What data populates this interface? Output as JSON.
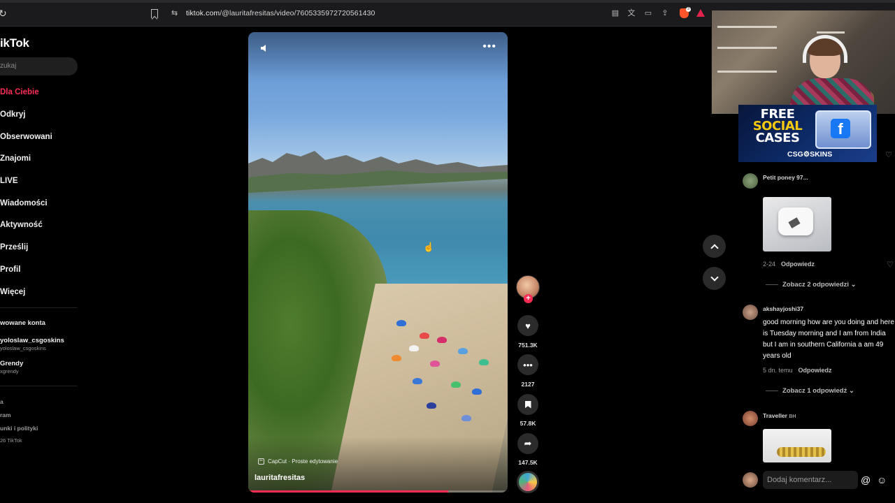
{
  "browser": {
    "url_host": "tiktok.com",
    "url_path": "/@lauritafresitas/video/7605335972720561430"
  },
  "sidebar": {
    "logo": "ikTok",
    "search_placeholder": "zukaj",
    "nav": [
      {
        "label": "Dla Ciebie",
        "active": true
      },
      {
        "label": "Odkryj"
      },
      {
        "label": "Obserwowani"
      },
      {
        "label": "Znajomi"
      },
      {
        "label": "LIVE"
      },
      {
        "label": "Wiadomości"
      },
      {
        "label": "Aktywność"
      },
      {
        "label": "Prześlij"
      },
      {
        "label": "Profil"
      },
      {
        "label": "Więcej"
      }
    ],
    "following_title": "wowane konta",
    "accounts": [
      {
        "name": "yoloslaw_csgoskins",
        "handle": "yoloslaw_csgoskins"
      },
      {
        "name": "Grendy",
        "handle": "xgrendy"
      }
    ],
    "footer": [
      "a",
      "ram",
      "unki i polityki",
      "26 TikTok"
    ]
  },
  "video": {
    "author": "lauritafresitas",
    "capcut_label": "CapCut · Proste edytowanie",
    "progress": 0.77,
    "more_label": "•••"
  },
  "actions": {
    "likes": "751.3K",
    "comments": "2127",
    "saves": "57.8K",
    "shares": "147.5K"
  },
  "ad": {
    "line1": "FREE",
    "line2": "SOCIAL",
    "line3": "CASES",
    "brand": "CSG⚙SKINS"
  },
  "comments": [
    {
      "user": "Petit poney 97...",
      "meta": "2-24",
      "reply": "Odpowiedz",
      "more_replies": "Zobacz 2 odpowiedzi ⌄"
    },
    {
      "user": "akshayjoshi37",
      "text": "good morning how are you doing and here is Tuesday morning and I am from India but I am in southern California a am 49 years old",
      "meta": "5 dn. temu",
      "reply": "Odpowiedz",
      "more_replies": "Zobacz 1 odpowiedź ⌄"
    },
    {
      "user": "Traveller",
      "badge": "BH"
    }
  ],
  "comment_input": {
    "placeholder": "Dodaj komentarz...",
    "mention_icon": "@",
    "emoji_icon": "☺"
  },
  "colors": {
    "accent": "#fe2c55",
    "background": "#000000"
  }
}
